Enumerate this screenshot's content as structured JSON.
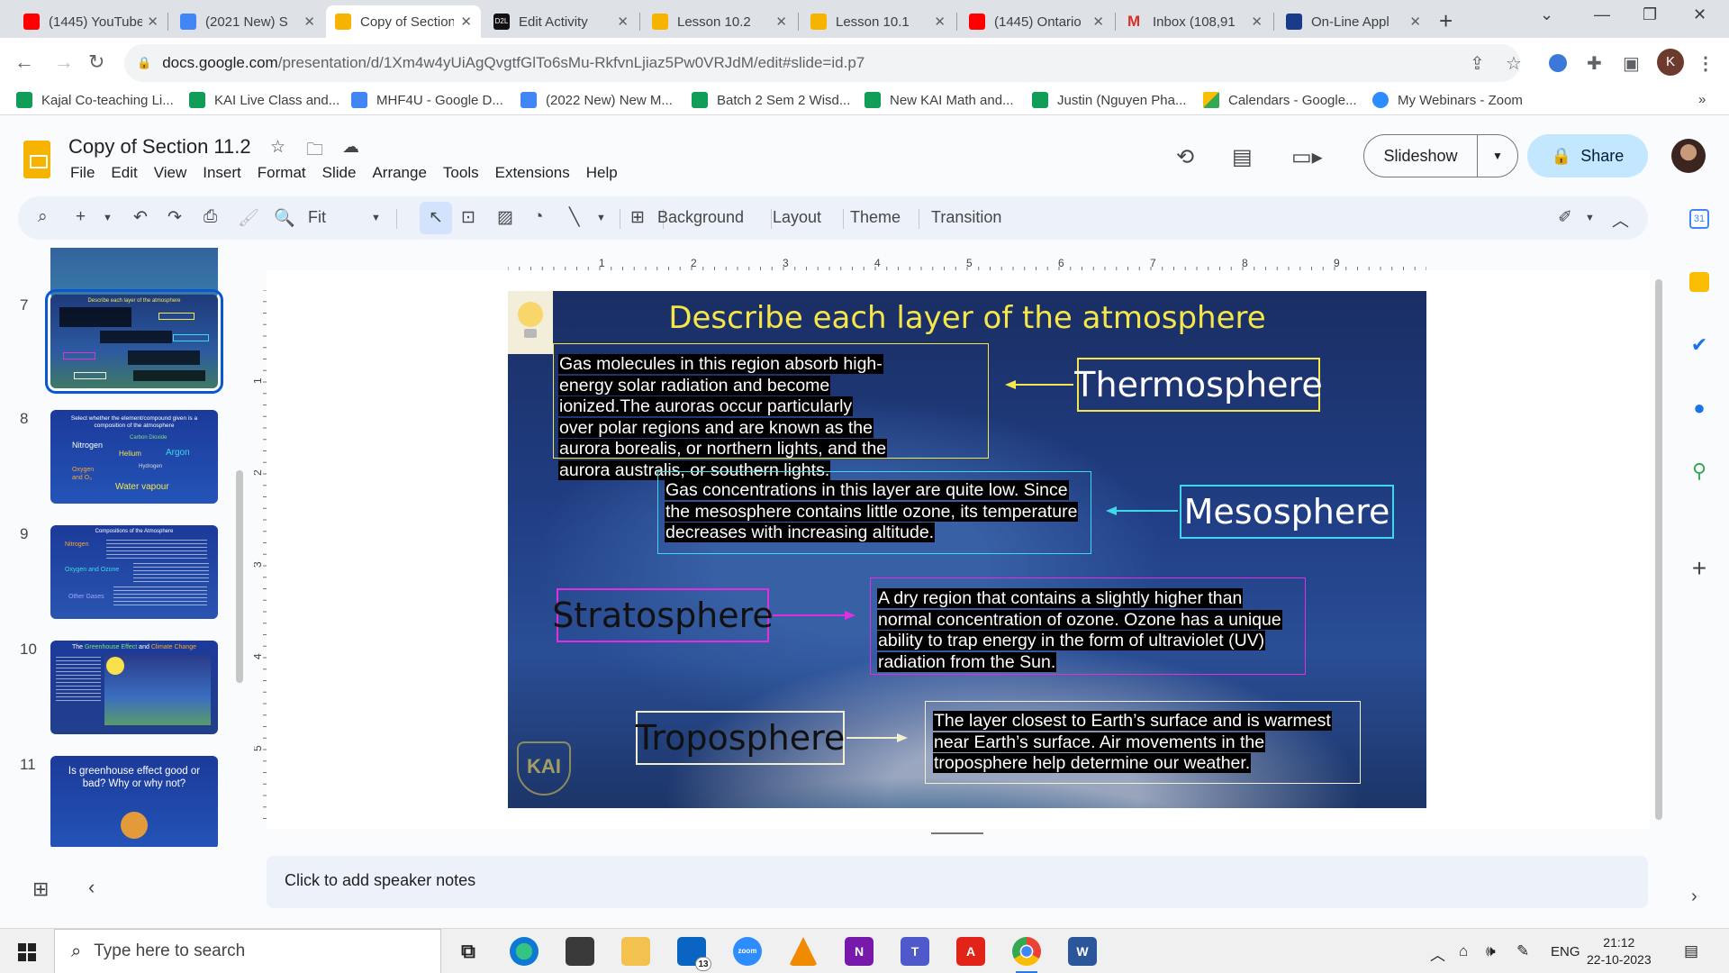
{
  "browser": {
    "tabs": [
      {
        "title": "(1445) YouTube",
        "color": "#ff0000",
        "active": false
      },
      {
        "title": "(2021 New) S",
        "color": "#4285f4",
        "active": false
      },
      {
        "title": "Copy of Section 11.2",
        "color": "#f6b400",
        "active": true
      },
      {
        "title": "Edit Activity",
        "color": "#111111",
        "active": false
      },
      {
        "title": "Lesson 10.2",
        "color": "#f6b400",
        "active": false
      },
      {
        "title": "Lesson 10.1",
        "color": "#f6b400",
        "active": false
      },
      {
        "title": "(1445) Ontario",
        "color": "#ff0000",
        "active": false
      },
      {
        "title": "Inbox (108,91",
        "color": "#d93025",
        "active": false
      },
      {
        "title": "On-Line Appl",
        "color": "#1a3a8a",
        "active": false
      }
    ],
    "url_host": "docs.google.com",
    "url_path": "/presentation/d/1Xm4w4yUiAgQvgtfGlTo6sMu-RkfvnLjiaz5Pw0VRJdM/edit#slide=id.p7",
    "profile_initial": "K",
    "bookmarks": [
      {
        "label": "Kajal Co-teaching Li...",
        "color": "#0f9d58"
      },
      {
        "label": "KAI Live Class and...",
        "color": "#0f9d58"
      },
      {
        "label": "MHF4U - Google D...",
        "color": "#4285f4"
      },
      {
        "label": "(2022 New) New M...",
        "color": "#4285f4"
      },
      {
        "label": "Batch 2 Sem 2 Wisd...",
        "color": "#0f9d58"
      },
      {
        "label": "New KAI Math and...",
        "color": "#0f9d58"
      },
      {
        "label": "Justin (Nguyen Pha...",
        "color": "#0f9d58"
      },
      {
        "label": "Calendars - Google...",
        "color": "#fbbc04"
      },
      {
        "label": "My Webinars - Zoom",
        "color": "#2d8cff"
      }
    ]
  },
  "doc": {
    "title": "Copy of Section 11.2",
    "menu": [
      "File",
      "Edit",
      "View",
      "Insert",
      "Format",
      "Slide",
      "Arrange",
      "Tools",
      "Extensions",
      "Help"
    ],
    "slideshow_label": "Slideshow",
    "share_label": "Share"
  },
  "toolbar": {
    "zoom": "Fit",
    "background_label": "Background",
    "layout_label": "Layout",
    "theme_label": "Theme",
    "transition_label": "Transition"
  },
  "filmstrip": {
    "numbers": [
      "7",
      "8",
      "9",
      "10",
      "11"
    ],
    "selected": "7",
    "thumb8": {
      "title": "Select whether the element/compound given is a composition of the atmosphere",
      "items": [
        "Nitrogen",
        "Carbon Dioxide",
        "Helium",
        "Argon",
        "Hydrogen",
        "Oxygen and O₃",
        "Water vapour"
      ]
    },
    "thumb9": {
      "title": "Compositions of the Atmosphere",
      "items": [
        "Nitrogen",
        "Oxygen and Ozone",
        "Other Gases"
      ]
    },
    "thumb10": {
      "title_a": "The ",
      "title_b": "Greenhouse Effect",
      "title_c": " and ",
      "title_d": "Climate Change"
    },
    "thumb11": {
      "title": "Is greenhouse effect good or bad? Why or why not?"
    }
  },
  "ruler": {
    "h": [
      "1",
      "2",
      "3",
      "4",
      "5",
      "6",
      "7",
      "8",
      "9"
    ],
    "v": [
      "1",
      "2",
      "3",
      "4",
      "5"
    ]
  },
  "slide": {
    "title": "Describe each layer of the atmosphere",
    "thermo_desc": "Gas molecules in this region absorb high-energy solar radiation and become ionized.The auroras occur particularly over polar regions and are known as the aurora borealis, or northern lights, and the aurora australis, or southern lights.",
    "thermo_label": "Thermosphere",
    "meso_desc": "Gas concentrations in this layer are quite low. Since the mesosphere contains little ozone, its temperature decreases with increasing altitude.",
    "meso_label": "Mesosphere",
    "strato_label": "Stratosphere",
    "strato_desc": "A dry region that contains a slightly higher than normal concentration of ozone. Ozone has a unique ability to trap energy in the form of ultraviolet (UV) radiation from the Sun.",
    "tropo_label": "Troposphere",
    "tropo_desc": "The layer closest to Earth’s surface and is warmest near Earth’s surface. Air movements in the troposphere help determine our weather.",
    "watermark": "KAI",
    "colors": {
      "thermo": "#f5e64a",
      "meso": "#3fd8e8",
      "strato": "#e02fe0",
      "tropo": "#f3efcf"
    }
  },
  "notes": {
    "placeholder": "Click to add speaker notes"
  },
  "taskbar": {
    "search_placeholder": "Type here to search",
    "mail_badge": "13",
    "lang": "ENG",
    "time": "21:12",
    "date": "22-10-2023"
  }
}
